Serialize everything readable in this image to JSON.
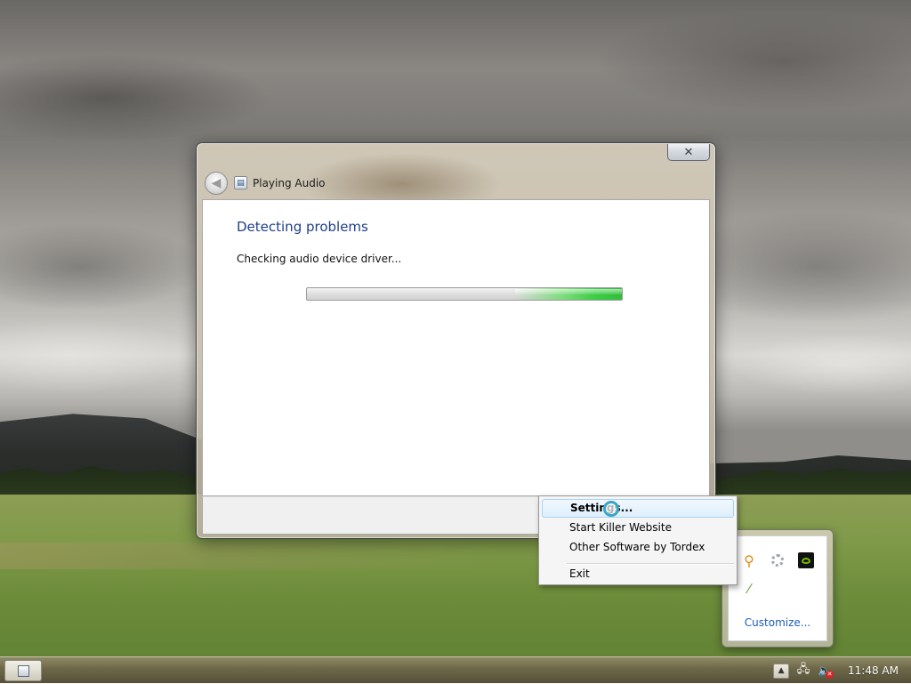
{
  "window": {
    "title": "Playing Audio",
    "heading": "Detecting problems",
    "status": "Checking audio device driver...",
    "progress_fraction": 0.34
  },
  "context_menu": {
    "items": [
      {
        "label": "Settings...",
        "bold": true,
        "selected": true
      },
      {
        "label": "Start Killer Website"
      },
      {
        "label": "Other Software by Tordex"
      },
      {
        "label": "Exit"
      }
    ]
  },
  "tray_flyout": {
    "customize_label": "Customize...",
    "icons": [
      "key-icon",
      "ring-icon",
      "nvidia-icon",
      "pen-icon"
    ]
  },
  "taskbar": {
    "clock": "11:48 AM"
  },
  "colors": {
    "heading": "#1e3f8a",
    "progress_green": "#3ccc46",
    "link": "#1e5bb8"
  }
}
